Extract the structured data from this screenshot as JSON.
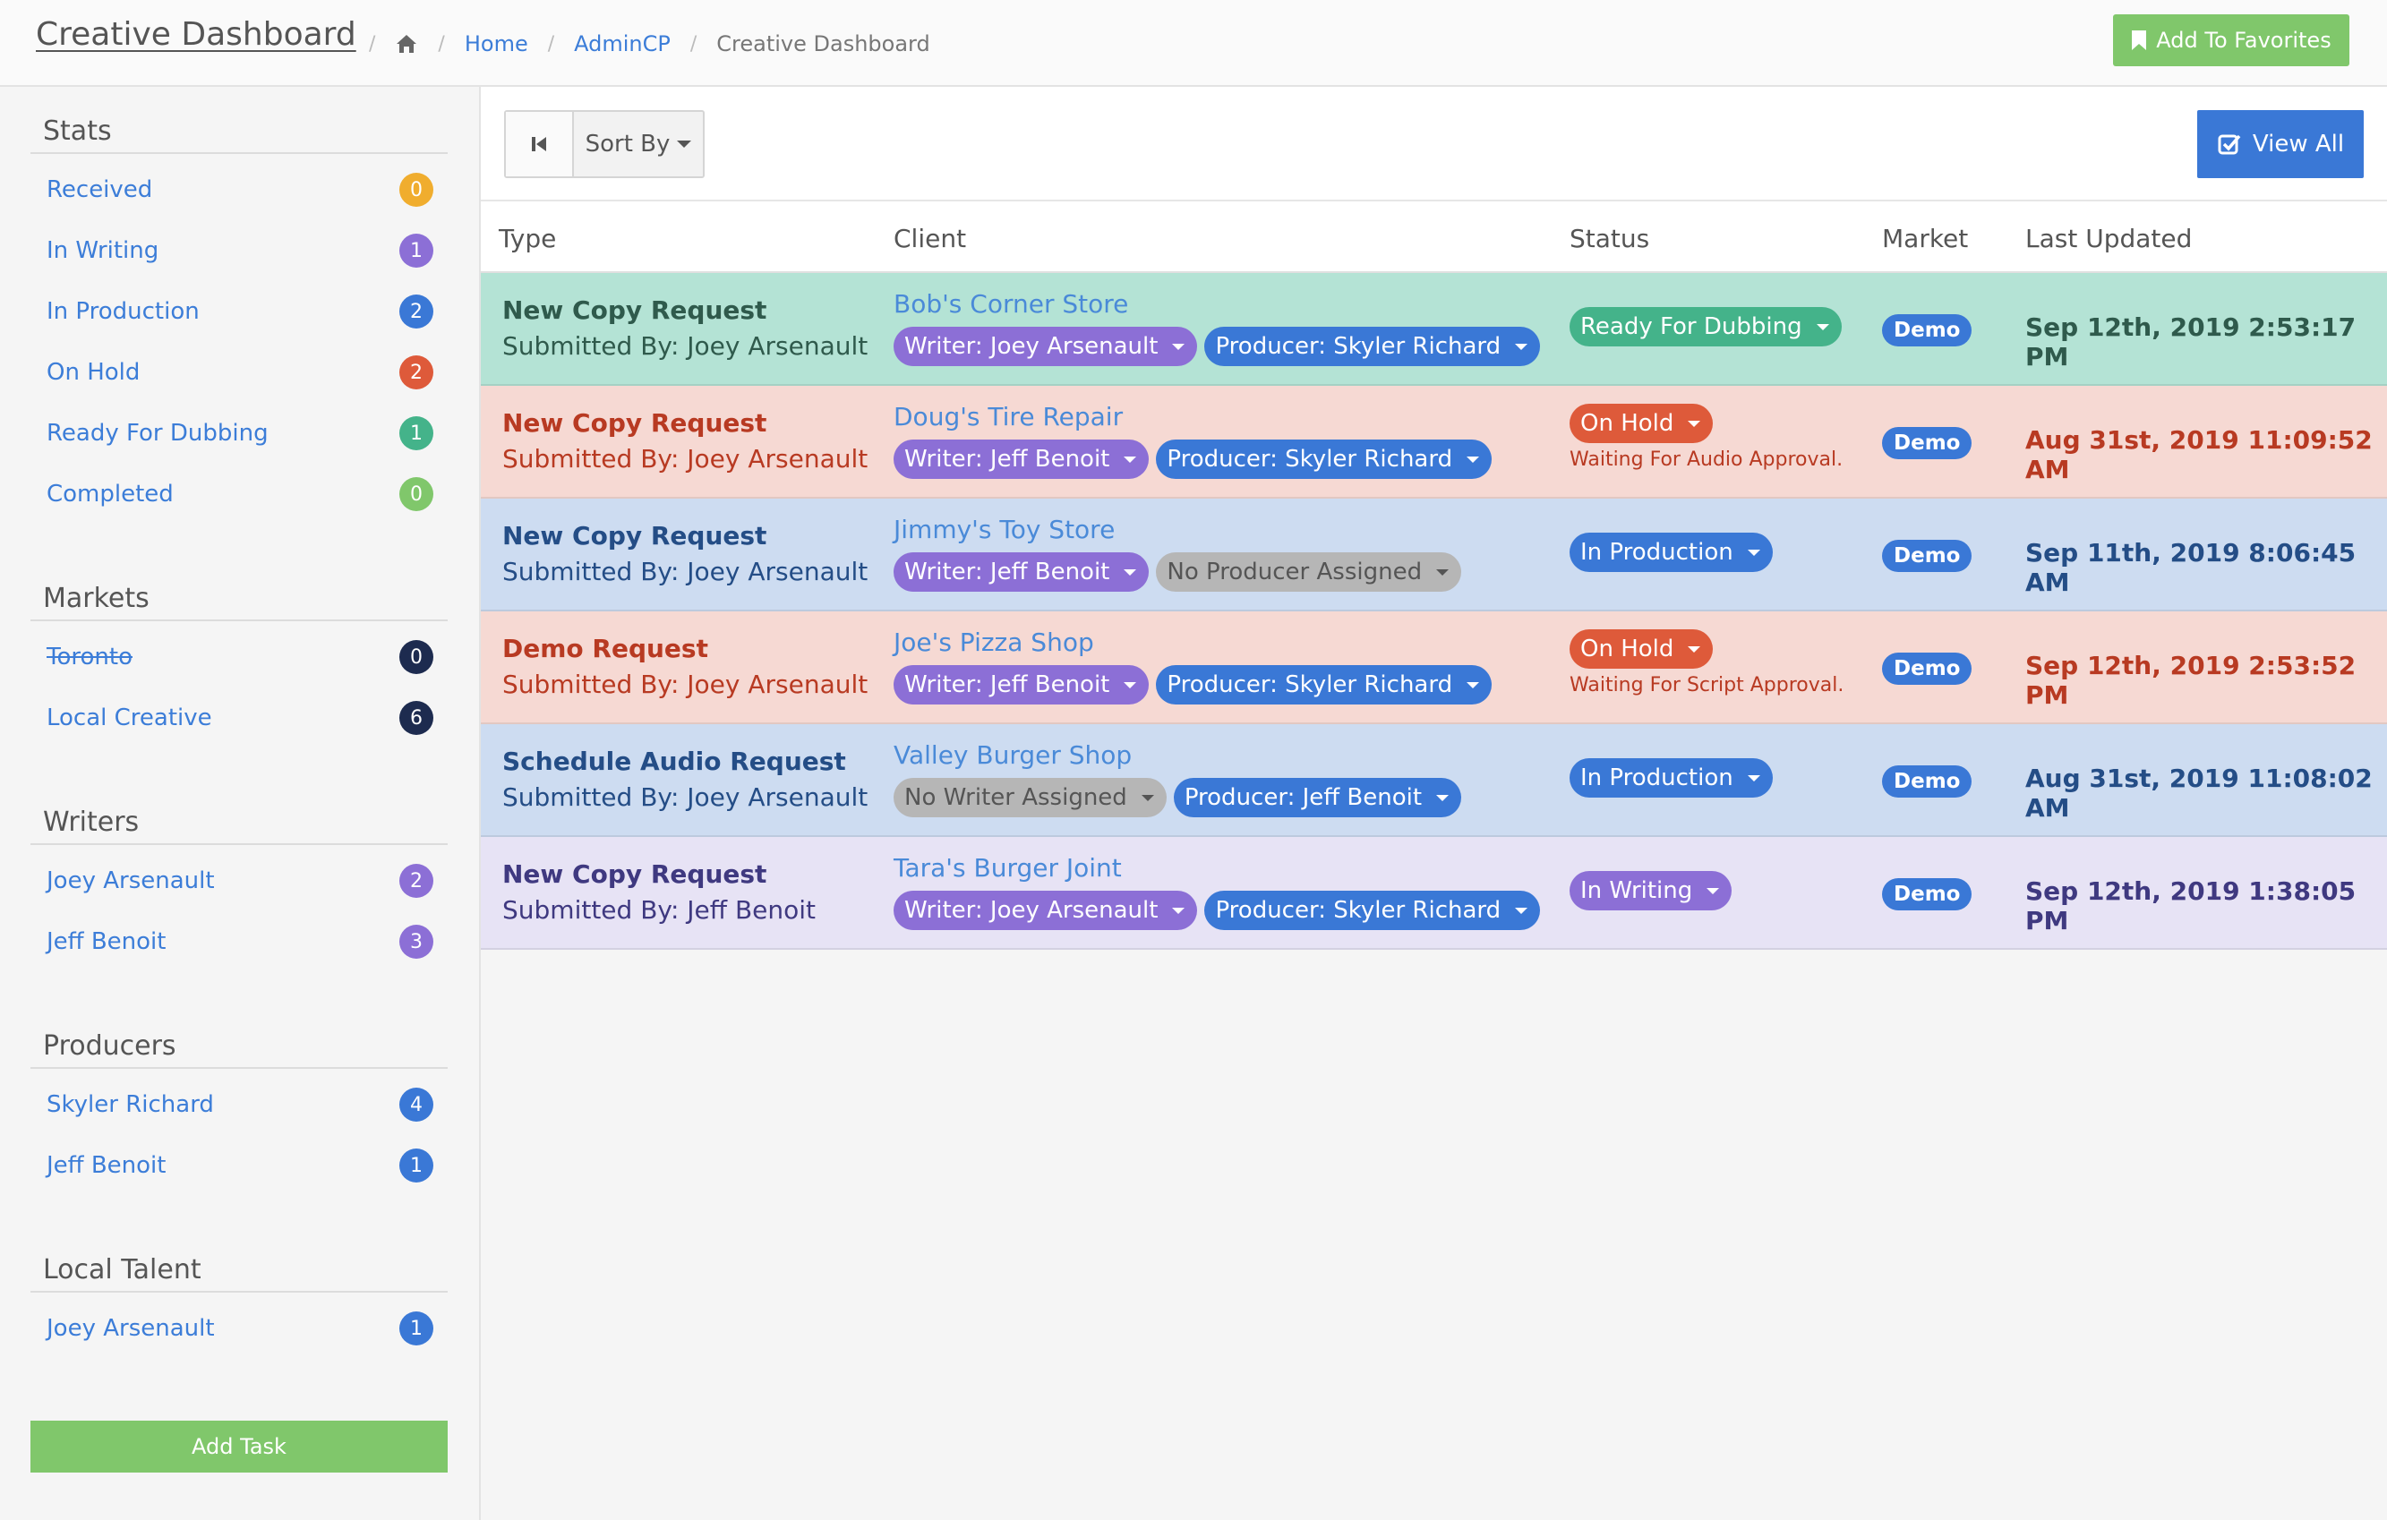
{
  "header": {
    "title": "Creative Dashboard",
    "breadcrumb": {
      "home_icon": "home-icon",
      "items": [
        "Home",
        "AdminCP",
        "Creative Dashboard"
      ]
    },
    "favorites_label": "Add To Favorites"
  },
  "sidebar": {
    "stats": {
      "heading": "Stats",
      "items": [
        {
          "label": "Received",
          "count": "0",
          "color": "#f0ad2e"
        },
        {
          "label": "In Writing",
          "count": "1",
          "color": "#8c6fd6"
        },
        {
          "label": "In Production",
          "count": "2",
          "color": "#3a78d6"
        },
        {
          "label": "On Hold",
          "count": "2",
          "color": "#de5a3a"
        },
        {
          "label": "Ready For Dubbing",
          "count": "1",
          "color": "#44b38a"
        },
        {
          "label": "Completed",
          "count": "0",
          "color": "#80c76b"
        }
      ]
    },
    "markets": {
      "heading": "Markets",
      "items": [
        {
          "label": "Toronto",
          "count": "0",
          "color": "#1d2b4f",
          "strikethrough": true
        },
        {
          "label": "Local Creative",
          "count": "6",
          "color": "#1d2b4f"
        }
      ]
    },
    "writers": {
      "heading": "Writers",
      "items": [
        {
          "label": "Joey Arsenault",
          "count": "2",
          "color": "#8c6fd6"
        },
        {
          "label": "Jeff Benoit",
          "count": "3",
          "color": "#8c6fd6"
        }
      ]
    },
    "producers": {
      "heading": "Producers",
      "items": [
        {
          "label": "Skyler Richard",
          "count": "4",
          "color": "#3a78d6"
        },
        {
          "label": "Jeff Benoit",
          "count": "1",
          "color": "#3a78d6"
        }
      ]
    },
    "talent": {
      "heading": "Local Talent",
      "items": [
        {
          "label": "Joey Arsenault",
          "count": "1",
          "color": "#3a78d6"
        }
      ]
    },
    "add_task_label": "Add Task"
  },
  "toolbar": {
    "sort_label": "Sort By",
    "view_all_label": "View All"
  },
  "table": {
    "columns": [
      "Type",
      "Client",
      "Status",
      "Market",
      "Last Updated"
    ],
    "rows": [
      {
        "type": "New Copy Request",
        "submitted": "Submitted By: Joey Arsenault",
        "client": "Bob's Corner Store",
        "writer": "Writer: Joey Arsenault",
        "producer": "Producer: Skyler Richard",
        "status": "Ready For Dubbing",
        "status_note": "",
        "market": "Demo",
        "updated": "Sep 12th, 2019 2:53:17 PM",
        "bg": "#b4e3d5",
        "fg": "#2f5a4c",
        "status_color": "#44b38a"
      },
      {
        "type": "New Copy Request",
        "submitted": "Submitted By: Joey Arsenault",
        "client": "Doug's Tire Repair",
        "writer": "Writer: Jeff Benoit",
        "producer": "Producer: Skyler Richard",
        "status": "On Hold",
        "status_note": "Waiting For Audio Approval.",
        "market": "Demo",
        "updated": "Aug 31st, 2019 11:09:52 AM",
        "bg": "#f6d9d3",
        "fg": "#b83a22",
        "status_color": "#de5a3a"
      },
      {
        "type": "New Copy Request",
        "submitted": "Submitted By: Joey Arsenault",
        "client": "Jimmy's Toy Store",
        "writer": "Writer: Jeff Benoit",
        "producer": "No Producer Assigned",
        "status": "In Production",
        "status_note": "",
        "market": "Demo",
        "updated": "Sep 11th, 2019 8:06:45 AM",
        "bg": "#cddcf1",
        "fg": "#244d86",
        "status_color": "#3a78d6"
      },
      {
        "type": "Demo Request",
        "submitted": "Submitted By: Joey Arsenault",
        "client": "Joe's Pizza Shop",
        "writer": "Writer: Jeff Benoit",
        "producer": "Producer: Skyler Richard",
        "status": "On Hold",
        "status_note": "Waiting For Script Approval.",
        "market": "Demo",
        "updated": "Sep 12th, 2019 2:53:52 PM",
        "bg": "#f6d9d3",
        "fg": "#b83a22",
        "status_color": "#de5a3a"
      },
      {
        "type": "Schedule Audio Request",
        "submitted": "Submitted By: Joey Arsenault",
        "client": "Valley Burger Shop",
        "writer": "No Writer Assigned",
        "producer": "Producer: Jeff Benoit",
        "status": "In Production",
        "status_note": "",
        "market": "Demo",
        "updated": "Aug 31st, 2019 11:08:02 AM",
        "bg": "#cddcf1",
        "fg": "#244d86",
        "status_color": "#3a78d6"
      },
      {
        "type": "New Copy Request",
        "submitted": "Submitted By: Jeff Benoit",
        "client": "Tara's Burger Joint",
        "writer": "Writer: Joey Arsenault",
        "producer": "Producer: Skyler Richard",
        "status": "In Writing",
        "status_note": "",
        "market": "Demo",
        "updated": "Sep 12th, 2019 1:38:05 PM",
        "bg": "#e7e3f5",
        "fg": "#3f3980",
        "status_color": "#8c6fd6"
      }
    ]
  },
  "colors": {
    "writer_pill": "#8c6fd6",
    "producer_pill": "#3a78d6",
    "unassigned_pill": "#b6b6b6"
  }
}
